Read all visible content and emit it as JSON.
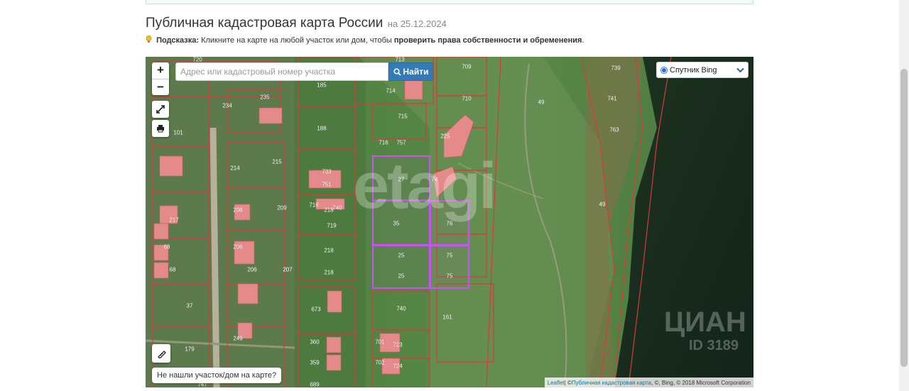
{
  "header": {
    "title": "Публичная кадастровая карта России",
    "date": "на 25.12.2024"
  },
  "hint": {
    "label": "Подсказка:",
    "text": "Кликните на карте на любой участок или дом, чтобы",
    "bold": "проверить права собственности и обременения",
    "end": "."
  },
  "map": {
    "zoom_in": "+",
    "zoom_out": "−",
    "search_placeholder": "Адрес или кадастровый номер участка",
    "search_button": "Найти",
    "layer_selected": "Спутник Bing",
    "not_found": "Не нашли участок/дом на карте?",
    "attribution": {
      "leaflet": "Leaflet",
      "sep": " | © ",
      "pkk": "Публичная кадастровая карта",
      "rest": ", ©, Bing, © 2018 Microsoft Corporation"
    },
    "watermarks": {
      "etagi": "etagi",
      "cian": "ЦИАН",
      "id": "ID 3189"
    },
    "plot_labels": [
      "720",
      "713",
      "709",
      "739",
      "185",
      "714",
      "710",
      "235",
      "234",
      "49",
      "741",
      "715",
      "101",
      "188",
      "716",
      "757",
      "225",
      "763",
      "214",
      "215",
      "733",
      "27",
      "74",
      "751",
      "218",
      "208",
      "209",
      "718",
      "740",
      "49",
      "217",
      "719",
      "35",
      "76",
      "68",
      "206",
      "207",
      "218",
      "25",
      "75",
      "68",
      "206",
      "207",
      "218",
      "25",
      "75",
      "37",
      "673",
      "740",
      "161",
      "360",
      "701",
      "723",
      "179",
      "249",
      "359",
      "702",
      "724",
      "689",
      "747"
    ]
  },
  "colors": {
    "selected_outline": "#c455f2",
    "cadastral_line": "#d93a3a",
    "building_fill": "#e58a8a",
    "primary": "#337ab7"
  }
}
